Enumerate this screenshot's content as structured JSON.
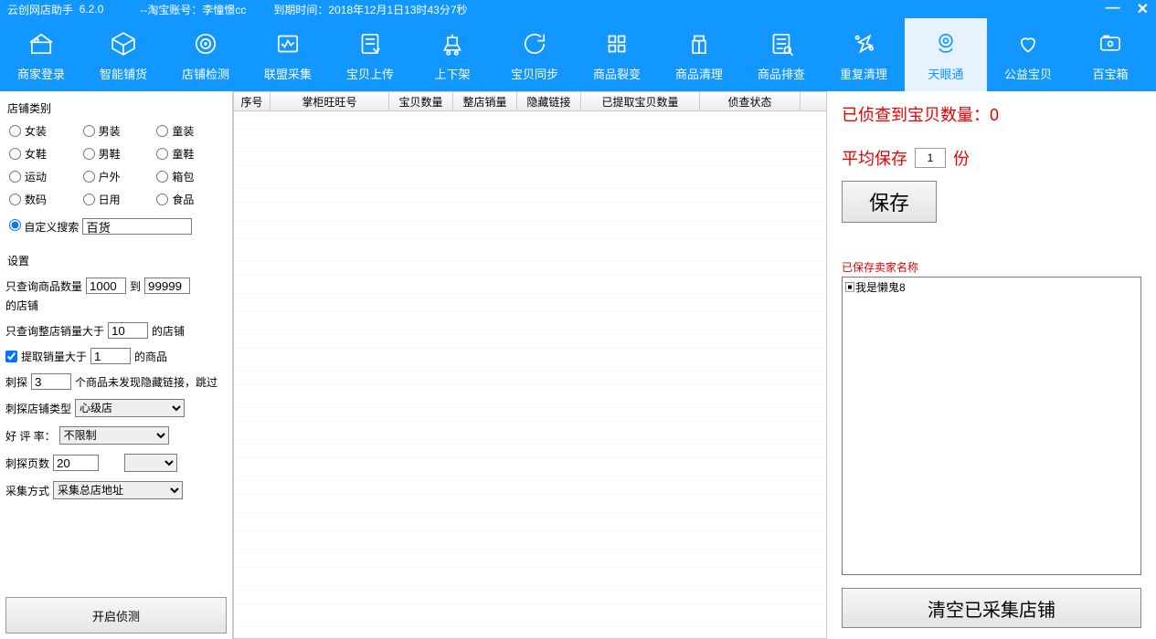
{
  "title": {
    "app": "云创网店助手",
    "version": "6.2.0",
    "account_prefix": "--淘宝账号：",
    "account": "李憧憬cc",
    "expire_prefix": "到期时间：",
    "expire": "2018年12月1日13时43分7秒"
  },
  "toolbar": [
    {
      "label": "商家登录"
    },
    {
      "label": "智能铺货"
    },
    {
      "label": "店铺检测"
    },
    {
      "label": "联盟采集"
    },
    {
      "label": "宝贝上传"
    },
    {
      "label": "上下架"
    },
    {
      "label": "宝贝同步"
    },
    {
      "label": "商品裂变"
    },
    {
      "label": "商品清理"
    },
    {
      "label": "商品排查"
    },
    {
      "label": "重复清理"
    },
    {
      "label": "天眼通"
    },
    {
      "label": "公益宝贝"
    },
    {
      "label": "百宝箱"
    }
  ],
  "sidebar": {
    "category_title": "店铺类别",
    "categories": [
      "女装",
      "男装",
      "童装",
      "女鞋",
      "男鞋",
      "童鞋",
      "运动",
      "户外",
      "箱包",
      "数码",
      "日用",
      "食品"
    ],
    "custom_search_label": "自定义搜索",
    "custom_search_value": "百货",
    "settings_title": "设置",
    "s1_a": "只查询商品数量",
    "s1_b": "到",
    "s1_c": "的店铺",
    "s1_v1": "1000",
    "s1_v2": "99999",
    "s2_a": "只查询整店销量大于",
    "s2_b": "的店铺",
    "s2_v": "10",
    "s3_a": "提取销量大于",
    "s3_b": "的商品",
    "s3_v": "1",
    "s4_a": "刺探",
    "s4_b": "个商品未发现隐藏链接，跳过",
    "s4_v": "3",
    "s5_a": "刺探店铺类型",
    "s5_v": "心级店",
    "s6_a": "好 评 率：",
    "s6_v": "不限制",
    "s7_a": "刺探页数",
    "s7_v": "20",
    "s8_a": "采集方式",
    "s8_v": "采集总店地址",
    "start_btn": "开启侦测"
  },
  "table": {
    "cols": [
      "序号",
      "掌柜旺旺号",
      "宝贝数量",
      "整店销量",
      "隐藏链接",
      "已提取宝贝数量",
      "侦查状态"
    ]
  },
  "right": {
    "detected_prefix": "已侦查到宝贝数量：",
    "detected_count": "0",
    "avg_prefix": "平均保存",
    "avg_value": "1",
    "avg_suffix": "份",
    "save_btn": "保存",
    "saved_label": "已保存卖家名称",
    "saved_items": [
      "我是懒鬼8"
    ],
    "clear_btn": "清空已采集店铺"
  }
}
